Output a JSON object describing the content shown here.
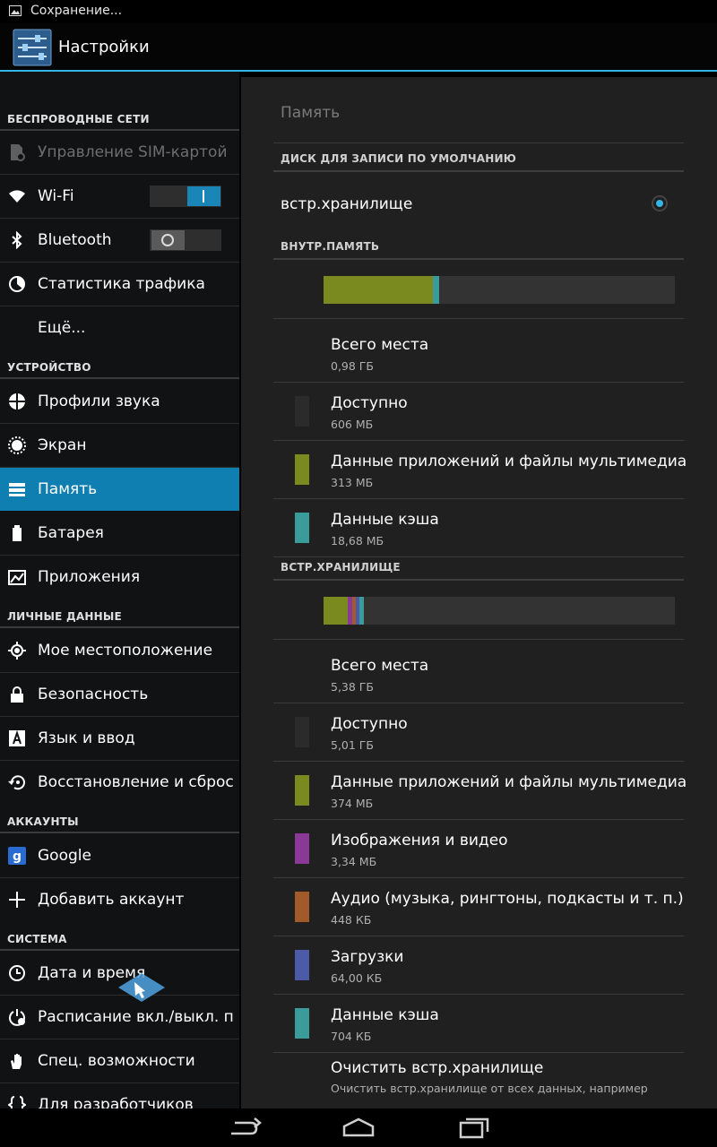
{
  "status_bar": {
    "text": "Сохранение..."
  },
  "action_bar": {
    "title": "Настройки"
  },
  "sidebar": {
    "sections": [
      {
        "label": "БЕСПРОВОДНЫЕ СЕТИ",
        "items": [
          {
            "label": "Управление SIM-картой",
            "icon": "sim-card-gear-icon",
            "disabled": true
          },
          {
            "label": "Wi-Fi",
            "icon": "wifi-icon",
            "toggle": "on"
          },
          {
            "label": "Bluetooth",
            "icon": "bluetooth-icon",
            "toggle": "off"
          },
          {
            "label": "Статистика трафика",
            "icon": "data-usage-icon"
          },
          {
            "label": "Ещё...",
            "icon": ""
          }
        ]
      },
      {
        "label": "УСТРОЙСТВО",
        "items": [
          {
            "label": "Профили звука",
            "icon": "sound-profiles-icon"
          },
          {
            "label": "Экран",
            "icon": "brightness-icon"
          },
          {
            "label": "Память",
            "icon": "storage-icon",
            "selected": true
          },
          {
            "label": "Батарея",
            "icon": "battery-icon"
          },
          {
            "label": "Приложения",
            "icon": "apps-icon"
          }
        ]
      },
      {
        "label": "ЛИЧНЫЕ ДАННЫЕ",
        "items": [
          {
            "label": "Мое местоположение",
            "icon": "location-icon"
          },
          {
            "label": "Безопасность",
            "icon": "lock-icon"
          },
          {
            "label": "Язык и ввод",
            "icon": "language-icon"
          },
          {
            "label": "Восстановление и сброс",
            "icon": "backup-restore-icon"
          }
        ]
      },
      {
        "label": "АККАУНТЫ",
        "items": [
          {
            "label": "Google",
            "icon": "google-icon"
          },
          {
            "label": "Добавить аккаунт",
            "icon": "plus-icon"
          }
        ]
      },
      {
        "label": "СИСТЕМА",
        "items": [
          {
            "label": "Дата и время",
            "icon": "clock-icon"
          },
          {
            "label": "Расписание вкл./выкл. п",
            "icon": "power-schedule-icon"
          },
          {
            "label": "Спец. возможности",
            "icon": "accessibility-hand-icon"
          },
          {
            "label": "Для разработчиков",
            "icon": "developer-braces-icon"
          }
        ]
      }
    ]
  },
  "detail": {
    "header": "Память",
    "default_disk": {
      "section_label": "ДИСК ДЛЯ ЗАПИСИ ПО УМОЛЧАНИЮ",
      "option": "встр.хранилище",
      "selected": true
    },
    "internal": {
      "section_label": "ВНУТР.ПАМЯТЬ",
      "bar_segments": [
        {
          "name": "apps",
          "fraction": 0.312,
          "color": "#7b8a1e"
        },
        {
          "name": "cache",
          "fraction": 0.019,
          "color": "#3a9c9a"
        }
      ],
      "rows": [
        {
          "title": "Всего места",
          "value": "0,98 ГБ",
          "color": ""
        },
        {
          "title": "Доступно",
          "value": "606 МБ",
          "color": "#2b2b2b"
        },
        {
          "title": "Данные приложений и файлы мультимедиа",
          "value": "313 МБ",
          "color": "#7b8a1e"
        },
        {
          "title": "Данные кэша",
          "value": "18,68 МБ",
          "color": "#3a9c9a"
        }
      ]
    },
    "external": {
      "section_label": "ВСТР.ХРАНИЛИЩЕ",
      "bar_segments": [
        {
          "name": "apps",
          "fraction": 0.069,
          "color": "#7b8a1e"
        },
        {
          "name": "images",
          "fraction": 0.013,
          "color": "#8a3a96"
        },
        {
          "name": "audio",
          "fraction": 0.009,
          "color": "#a35a2a"
        },
        {
          "name": "downloads",
          "fraction": 0.009,
          "color": "#4c5ba8"
        },
        {
          "name": "cache",
          "fraction": 0.013,
          "color": "#3a9c9a"
        }
      ],
      "rows": [
        {
          "title": "Всего места",
          "value": "5,38 ГБ",
          "color": ""
        },
        {
          "title": "Доступно",
          "value": "5,01 ГБ",
          "color": "#2b2b2b"
        },
        {
          "title": "Данные приложений и файлы мультимедиа",
          "value": "374 МБ",
          "color": "#7b8a1e"
        },
        {
          "title": "Изображения и видео",
          "value": "3,34 МБ",
          "color": "#8a3a96"
        },
        {
          "title": "Аудио (музыка, рингтоны, подкасты и т. п.)",
          "value": "448 КБ",
          "color": "#a35a2a"
        },
        {
          "title": "Загрузки",
          "value": "64,00 КБ",
          "color": "#4c5ba8"
        },
        {
          "title": "Данные кэша",
          "value": "704 КБ",
          "color": "#3a9c9a"
        }
      ]
    },
    "clear": {
      "title": "Очистить встр.хранилище",
      "description": "Очистить встр.хранилище от всех данных, например"
    }
  },
  "nav_bar": {
    "buttons": [
      "back-icon",
      "home-icon",
      "recent-apps-icon"
    ]
  }
}
